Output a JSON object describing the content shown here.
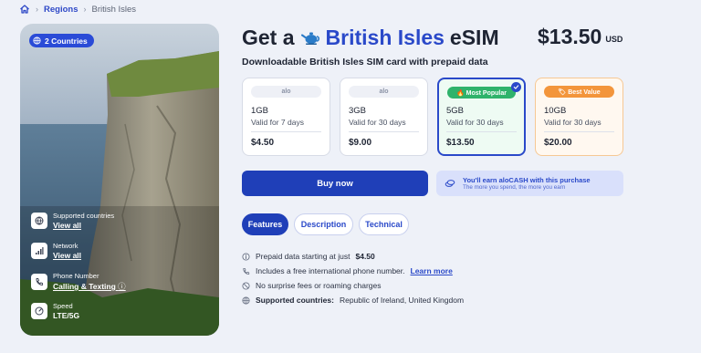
{
  "breadcrumb": {
    "home_icon": "home-icon",
    "regions": "Regions",
    "current": "British Isles"
  },
  "hero": {
    "badge": "2 Countries",
    "features": [
      {
        "label": "Supported countries",
        "value": "View all",
        "icon": "globe-icon"
      },
      {
        "label": "Network",
        "value": "View all",
        "icon": "signal-icon"
      },
      {
        "label": "Phone Number",
        "value": "Calling & Texting",
        "icon": "phone-icon"
      },
      {
        "label": "Speed",
        "value": "LTE/5G",
        "icon": "gauge-icon"
      }
    ]
  },
  "title": {
    "prefix": "Get a",
    "destination": "British Isles",
    "suffix": "eSIM"
  },
  "price": {
    "amount": "$13.50",
    "currency": "USD"
  },
  "subtitle": "Downloadable British Isles SIM card with prepaid data",
  "plans": [
    {
      "tag": "alo",
      "data": "1GB",
      "validity": "Valid for 7 days",
      "price": "$4.50"
    },
    {
      "tag": "alo",
      "data": "3GB",
      "validity": "Valid for 30 days",
      "price": "$9.00"
    },
    {
      "tag": "🔥 Most Popular",
      "data": "5GB",
      "validity": "Valid for 30 days",
      "price": "$13.50",
      "selected": true
    },
    {
      "tag": "🏷 Best Value",
      "data": "10GB",
      "validity": "Valid for 30 days",
      "price": "$20.00"
    }
  ],
  "buy_label": "Buy now",
  "alocash": {
    "line1": "You'll earn aloCASH with this purchase",
    "line2": "The more you spend, the more you earn"
  },
  "tabs": [
    "Features",
    "Description",
    "Technical"
  ],
  "features_list": {
    "prepaid_text": "Prepaid data starting at just",
    "prepaid_price": "$4.50",
    "phone_text": "Includes a free international phone number.",
    "learn_more": "Learn more",
    "fees_text": "No surprise fees or roaming charges",
    "countries_label": "Supported countries:",
    "countries_value": "Republic of Ireland, United Kingdom"
  },
  "colors": {
    "primary": "#1f3fb8",
    "accent": "#2a49c9",
    "popular": "#2fb36b",
    "best_value": "#f3953b"
  }
}
